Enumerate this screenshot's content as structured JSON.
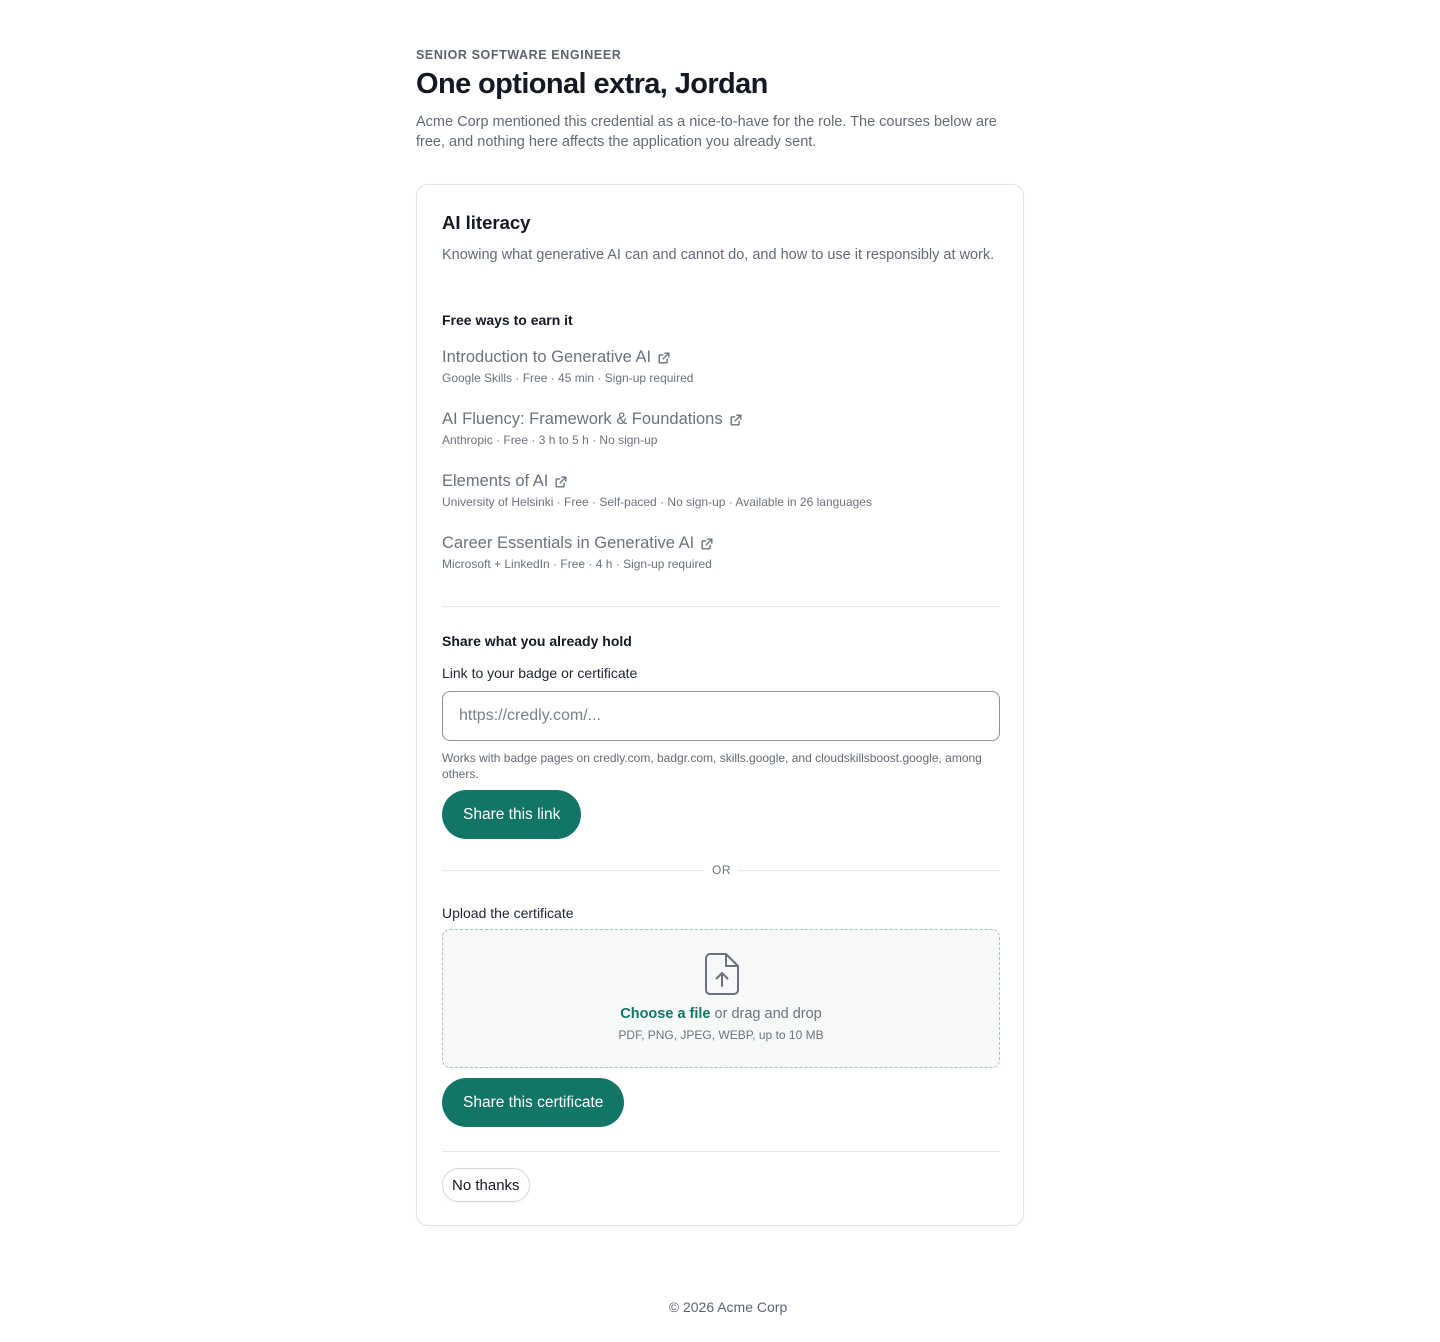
{
  "header": {
    "eyebrow": "SENIOR SOFTWARE ENGINEER",
    "title": "One optional extra, Jordan",
    "intro": "Acme Corp mentioned this credential as a nice-to-have for the role. The courses below are free, and nothing here affects the application you already sent."
  },
  "card": {
    "title": "AI literacy",
    "description": "Knowing what generative AI can and cannot do, and how to use it responsibly at work.",
    "courses_label": "Free ways to earn it",
    "courses": [
      {
        "title": "Introduction to Generative AI",
        "meta": "Google Skills · Free · 45 min · Sign-up required",
        "icon": "external-link-icon"
      },
      {
        "title": "AI Fluency: Framework & Foundations",
        "meta": "Anthropic · Free · 3 h to 5 h · No sign-up",
        "icon": "external-link-icon"
      },
      {
        "title": "Elements of AI",
        "meta": "University of Helsinki · Free · Self-paced · No sign-up · Available in 26 languages",
        "icon": "external-link-icon"
      },
      {
        "title": "Career Essentials in Generative AI",
        "meta": "Microsoft + LinkedIn · Free · 4 h · Sign-up required",
        "icon": "external-link-icon"
      }
    ],
    "share": {
      "section_label": "Share what you already hold",
      "link_label": "Link to your badge or certificate",
      "link_placeholder": "https://credly.com/...",
      "link_value": "",
      "link_hint": "Works with badge pages on credly.com, badgr.com, skills.google, and cloudskillsboost.google, among others.",
      "share_link_button": "Share this link",
      "or_text": "OR",
      "upload_label": "Upload the certificate",
      "upload_icon": "file-upload-icon",
      "upload_choose": "Choose a file",
      "upload_drag": " or drag and drop",
      "upload_formats": "PDF, PNG, JPEG, WEBP, up to 10 MB",
      "share_cert_button": "Share this certificate"
    },
    "decline_button": "No thanks"
  },
  "footer": {
    "text": "© 2026 Acme Corp"
  },
  "colors": {
    "accent": "#137566",
    "dropzone_border": "#9cc7bd",
    "muted_text": "#636975"
  }
}
